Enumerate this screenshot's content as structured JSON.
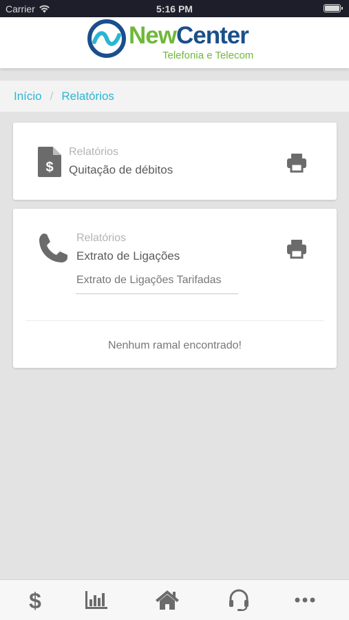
{
  "status_bar": {
    "carrier": "Carrier",
    "time": "5:16 PM"
  },
  "header": {
    "logo_name_part1": "New",
    "logo_name_part2": "Center",
    "logo_tagline": "Telefonia e Telecom"
  },
  "breadcrumb": {
    "home": "Início",
    "separator": "/",
    "current": "Relatórios"
  },
  "cards": [
    {
      "kicker": "Relatórios",
      "title": "Quitação de débitos",
      "icon": "invoice-icon",
      "action_icon": "print-icon"
    },
    {
      "kicker": "Relatórios",
      "title": "Extrato de Ligações",
      "icon": "phone-icon",
      "action_icon": "print-icon",
      "subitem": "Extrato de Ligações Tarifadas",
      "empty_message": "Nenhum ramal encontrado!"
    }
  ],
  "tabbar": {
    "items": [
      {
        "icon": "dollar-icon"
      },
      {
        "icon": "bar-chart-icon"
      },
      {
        "icon": "home-icon"
      },
      {
        "icon": "headset-icon"
      },
      {
        "icon": "more-icon"
      }
    ]
  },
  "colors": {
    "accent": "#2ab6d3",
    "icon_gray": "#6b6b6b",
    "logo_green": "#6fb83a",
    "logo_blue": "#1a4f8c"
  }
}
